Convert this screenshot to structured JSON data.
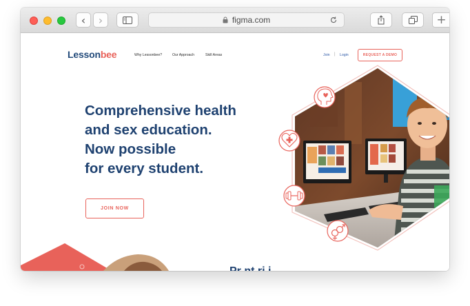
{
  "browser": {
    "url": "figma.com",
    "traffic_lights": {
      "close": "#fe5f57",
      "minimize": "#febc2e",
      "zoom": "#28c840"
    },
    "buttons": {
      "back": "‹",
      "forward": "›",
      "new_tab": "+"
    }
  },
  "site": {
    "logo": {
      "part1": "Lesson",
      "part2": "bee"
    },
    "nav": {
      "why": "Why Lessonbee?",
      "approach": "Our Approach",
      "skills": "Skill Areas"
    },
    "join_link": "Join",
    "separator": "|",
    "login_link": "Login",
    "demo_button": "REQUEST A DEMO",
    "hero": {
      "line1": "Comprehensive health",
      "line2": "and sex education.",
      "line3": "Now possible",
      "line4": "for every student."
    },
    "join_button": "JOIN NOW",
    "bottom_heading_partial": "Pr  nt  ri   i  "
  },
  "icons": {
    "head": "head-heart-icon",
    "medical": "heart-cross-icon",
    "fitness": "dumbbell-icon",
    "gender": "gender-symbols-icon"
  },
  "colors": {
    "brand_blue": "#1e4170",
    "brand_coral": "#e8625a",
    "nav_link": "#2f5aa8"
  }
}
